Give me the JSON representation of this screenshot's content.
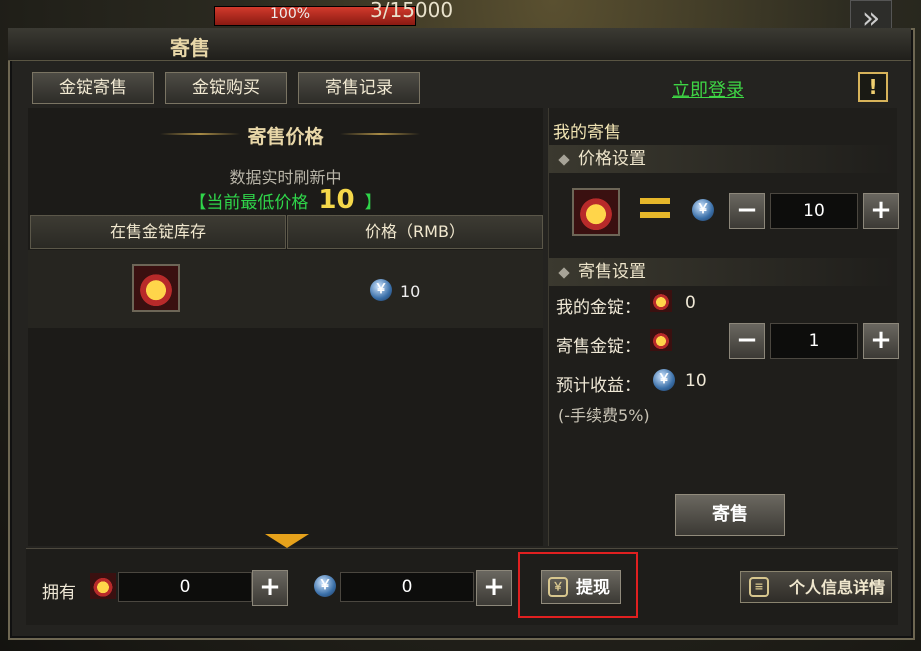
{
  "hud": {
    "hp_percent": "100%",
    "hp_text": "3/15000",
    "hp_fill": 1.0
  },
  "window": {
    "title": "寄售",
    "login_link": "立即登录",
    "alert": "!"
  },
  "tabs": [
    "金锭寄售",
    "金锭购买",
    "寄售记录"
  ],
  "left": {
    "section_title": "寄售价格",
    "refresh_text": "数据实时刷新中",
    "lowest_prefix": "【当前最低价格",
    "lowest_value": "10",
    "lowest_suffix": "】",
    "table_headers": [
      "在售金锭库存",
      "价格（RMB）"
    ],
    "rows": [
      {
        "price": "10"
      }
    ]
  },
  "right": {
    "my_sale_title": "我的寄售",
    "price_settings": "价格设置",
    "price_value": "10",
    "sale_settings": "寄售设置",
    "my_gold_label": "我的金锭：",
    "my_gold_value": "0",
    "sale_gold_label": "寄售金锭：",
    "sale_gold_value": "1",
    "expected_label": "预计收益：",
    "expected_value": "10",
    "fee_note": "(-手续费5%)",
    "sale_button": "寄售"
  },
  "bottom": {
    "own_label": "拥有",
    "gold_amount": "0",
    "rmb_amount": "0",
    "withdraw_button": "提现",
    "info_button": "个人信息详情"
  },
  "icons": {
    "coin": "￥",
    "plus": "+",
    "minus": "−"
  },
  "colors": {
    "accent_green": "#2fd54a",
    "gold": "#f5d84a",
    "highlight_red": "#e02020"
  }
}
